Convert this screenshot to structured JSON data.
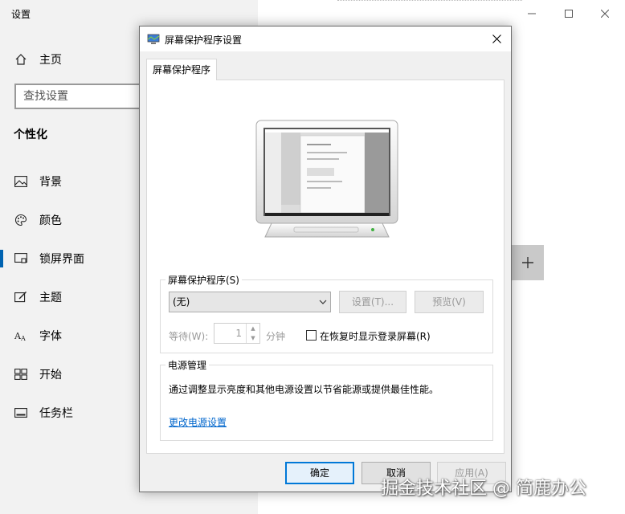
{
  "settings": {
    "title": "设置",
    "search_placeholder": "查找设置",
    "section_title": "个性化",
    "home_label": "主页",
    "nav": [
      {
        "label": "背景",
        "icon": "image-icon"
      },
      {
        "label": "颜色",
        "icon": "palette-icon"
      },
      {
        "label": "锁屏界面",
        "icon": "lock-screen-icon"
      },
      {
        "label": "主题",
        "icon": "theme-icon"
      },
      {
        "label": "字体",
        "icon": "font-icon"
      },
      {
        "label": "开始",
        "icon": "start-icon"
      },
      {
        "label": "任务栏",
        "icon": "taskbar-icon"
      }
    ],
    "active_index": 2,
    "window_controls": {
      "minimize": "—",
      "maximize": "☐",
      "close": "✕"
    },
    "plus": "+"
  },
  "dialog": {
    "title": "屏幕保护程序设置",
    "close": "✕",
    "tab_label": "屏幕保护程序",
    "screensaver_group": {
      "label": "屏幕保护程序(S)",
      "selected": "(无)",
      "settings_button": "设置(T)...",
      "preview_button": "预览(V)",
      "wait_label": "等待(W):",
      "wait_value": "1",
      "minutes_label": "分钟",
      "resume_checkbox_label": "在恢复时显示登录屏幕(R)",
      "resume_checked": false
    },
    "power_group": {
      "label": "电源管理",
      "description": "通过调整显示亮度和其他电源设置以节省能源或提供最佳性能。",
      "link": "更改电源设置"
    },
    "buttons": {
      "ok": "确定",
      "cancel": "取消",
      "apply": "应用(A)"
    }
  },
  "watermark": "掘金技术社区 @ 简鹿办公"
}
